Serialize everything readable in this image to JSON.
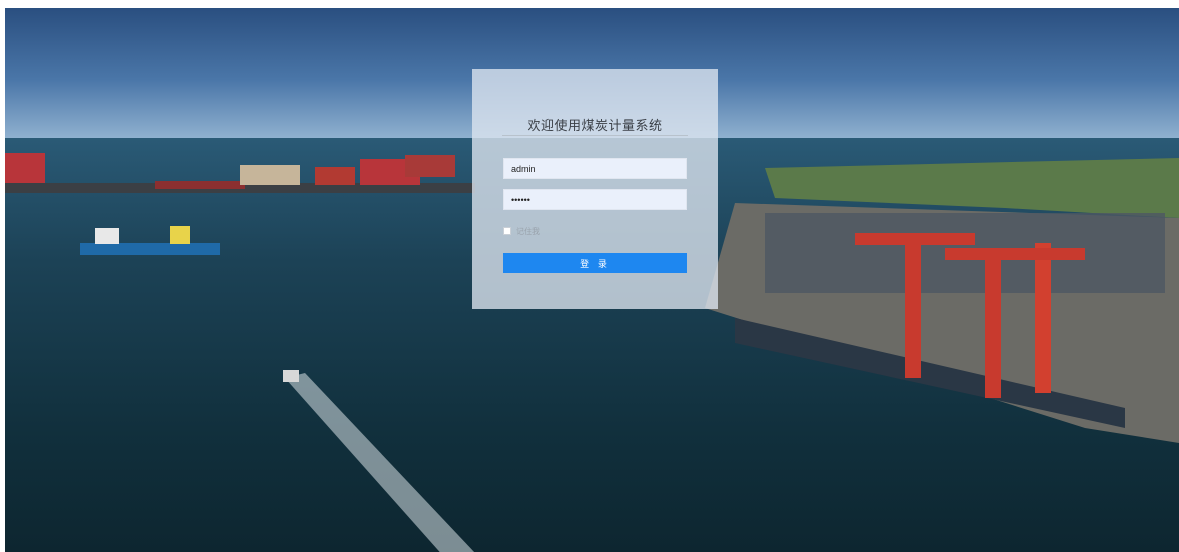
{
  "login": {
    "title": "欢迎使用煤炭计量系统",
    "username_value": "admin",
    "password_value": "••••••",
    "remember_label": "记住我",
    "login_button": "登 录"
  },
  "colors": {
    "button": "#1e87f0",
    "card_background": "rgba(222,230,240,0.78)"
  }
}
